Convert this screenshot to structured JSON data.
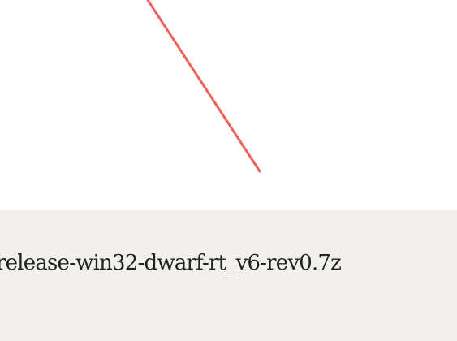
{
  "connector": {
    "color": "#f0615d"
  },
  "file_panel": {
    "filename": "release-win32-dwarf-rt_v6-rev0.7z",
    "background": "#f2f0ed"
  }
}
